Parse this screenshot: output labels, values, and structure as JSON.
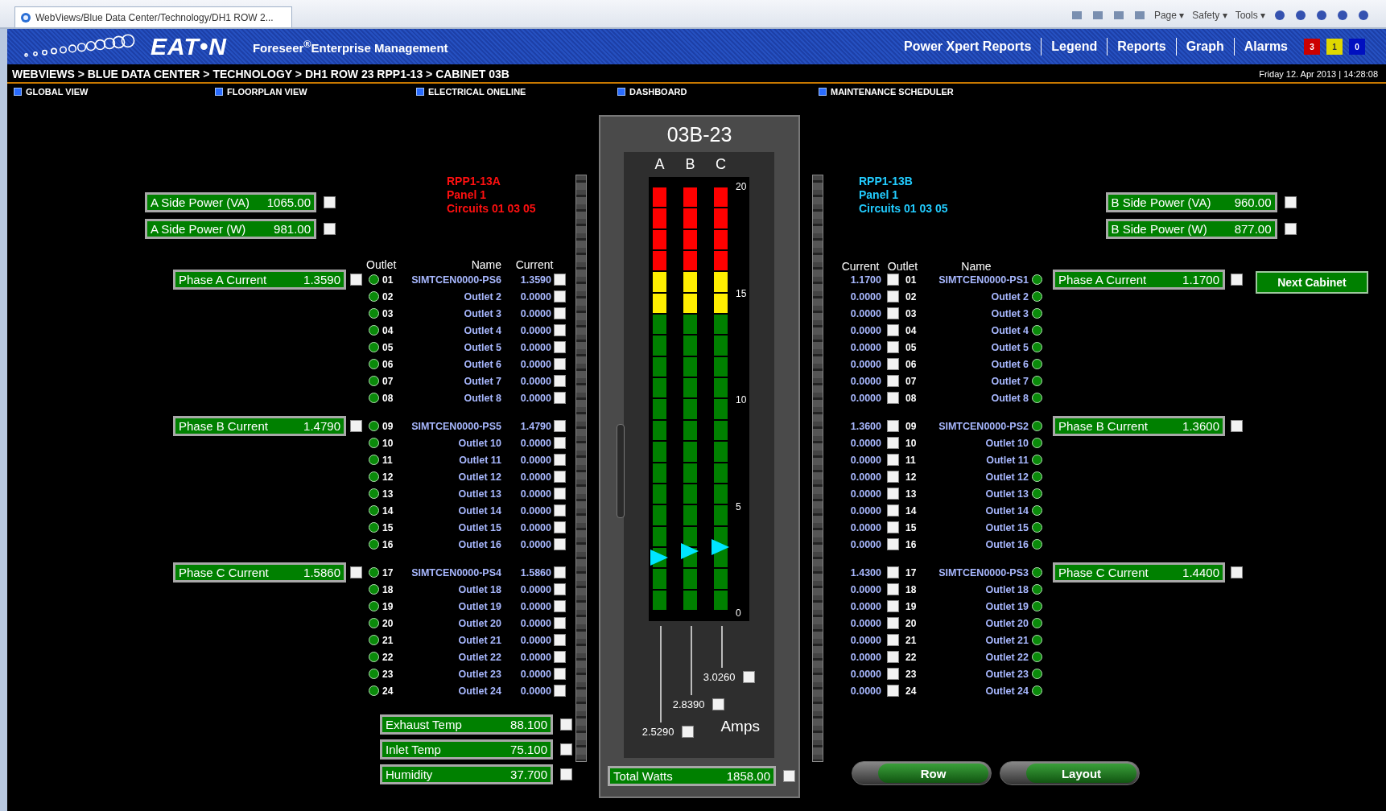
{
  "browser": {
    "tab_title": "WebViews/Blue Data Center/Technology/DH1 ROW 2...",
    "menus": [
      "Page ▾",
      "Safety ▾",
      "Tools ▾"
    ]
  },
  "header": {
    "logo": "EAT•N",
    "product": "Foreseer$^{®}$Enterprise Management",
    "nav": [
      "Power Xpert Reports",
      "Legend",
      "Reports",
      "Graph",
      "Alarms"
    ],
    "alarms": [
      {
        "count": "3",
        "color": "#cc0000"
      },
      {
        "count": "1",
        "color": "#e0d800"
      },
      {
        "count": "0",
        "color": "#0010c0"
      }
    ]
  },
  "breadcrumb": "WEBVIEWS > BLUE DATA CENTER > TECHNOLOGY > DH1 ROW 23 RPP1-13 > CABINET 03B",
  "datetime": "Friday 12. Apr 2013 | 14:28:08",
  "quick_links": [
    "GLOBAL VIEW",
    "FLOORPLAN VIEW",
    "ELECTRICAL ONELINE",
    "DASHBOARD",
    "MAINTENANCE SCHEDULER"
  ],
  "side_a": {
    "rpp": [
      "RPP1-13A",
      "Panel 1",
      "Circuits 01 03 05"
    ],
    "power": [
      {
        "label": "A Side Power (VA)",
        "value": "1065.00",
        "checked": false
      },
      {
        "label": "A Side Power (W)",
        "value": "981.00",
        "checked": false
      }
    ],
    "columns": [
      "Outlet",
      "Name",
      "Current"
    ],
    "groups": [
      {
        "phase": {
          "label": "Phase A Current",
          "value": "1.3590",
          "checked": false
        },
        "outlets": [
          {
            "number": "01",
            "name": "SIMTCEN0000-PS6",
            "current": "1.3590",
            "checked": false
          },
          {
            "number": "02",
            "name": "Outlet 2",
            "current": "0.0000",
            "checked": false
          },
          {
            "number": "03",
            "name": "Outlet 3",
            "current": "0.0000",
            "checked": false
          },
          {
            "number": "04",
            "name": "Outlet 4",
            "current": "0.0000",
            "checked": false
          },
          {
            "number": "05",
            "name": "Outlet 5",
            "current": "0.0000",
            "checked": false
          },
          {
            "number": "06",
            "name": "Outlet 6",
            "current": "0.0000",
            "checked": false
          },
          {
            "number": "07",
            "name": "Outlet 7",
            "current": "0.0000",
            "checked": false
          },
          {
            "number": "08",
            "name": "Outlet 8",
            "current": "0.0000",
            "checked": false
          }
        ]
      },
      {
        "phase": {
          "label": "Phase B Current",
          "value": "1.4790",
          "checked": false
        },
        "outlets": [
          {
            "number": "09",
            "name": "SIMTCEN0000-PS5",
            "current": "1.4790",
            "checked": false
          },
          {
            "number": "10",
            "name": "Outlet 10",
            "current": "0.0000",
            "checked": false
          },
          {
            "number": "11",
            "name": "Outlet 11",
            "current": "0.0000",
            "checked": false
          },
          {
            "number": "12",
            "name": "Outlet 12",
            "current": "0.0000",
            "checked": false
          },
          {
            "number": "13",
            "name": "Outlet 13",
            "current": "0.0000",
            "checked": false
          },
          {
            "number": "14",
            "name": "Outlet 14",
            "current": "0.0000",
            "checked": false
          },
          {
            "number": "15",
            "name": "Outlet 15",
            "current": "0.0000",
            "checked": false
          },
          {
            "number": "16",
            "name": "Outlet 16",
            "current": "0.0000",
            "checked": false
          }
        ]
      },
      {
        "phase": {
          "label": "Phase C Current",
          "value": "1.5860",
          "checked": false
        },
        "outlets": [
          {
            "number": "17",
            "name": "SIMTCEN0000-PS4",
            "current": "1.5860",
            "checked": false
          },
          {
            "number": "18",
            "name": "Outlet 18",
            "current": "0.0000",
            "checked": false
          },
          {
            "number": "19",
            "name": "Outlet 19",
            "current": "0.0000",
            "checked": false
          },
          {
            "number": "20",
            "name": "Outlet 20",
            "current": "0.0000",
            "checked": false
          },
          {
            "number": "21",
            "name": "Outlet 21",
            "current": "0.0000",
            "checked": false
          },
          {
            "number": "22",
            "name": "Outlet 22",
            "current": "0.0000",
            "checked": false
          },
          {
            "number": "23",
            "name": "Outlet 23",
            "current": "0.0000",
            "checked": false
          },
          {
            "number": "24",
            "name": "Outlet 24",
            "current": "0.0000",
            "checked": false
          }
        ]
      }
    ],
    "environment": [
      {
        "label": "Exhaust Temp",
        "value": "88.100",
        "checked": false
      },
      {
        "label": "Inlet Temp",
        "value": "75.100",
        "checked": false
      },
      {
        "label": "Humidity",
        "value": "37.700",
        "checked": false
      }
    ]
  },
  "cabinet": {
    "title": "03B-23",
    "scale": [
      "20",
      "15",
      "10",
      "5",
      "0"
    ],
    "unit": "Amps",
    "meters": [
      {
        "label": "A",
        "level": 0.1265,
        "reading": "2.5290",
        "checked": false
      },
      {
        "label": "B",
        "level": 0.142,
        "reading": "2.8390",
        "checked": false
      },
      {
        "label": "C",
        "level": 0.1513,
        "reading": "3.0260",
        "checked": false
      }
    ],
    "total": {
      "label": "Total Watts",
      "value": "1858.00",
      "checked": false
    }
  },
  "side_b": {
    "rpp": [
      "RPP1-13B",
      "Panel 1",
      "Circuits 01 03 05"
    ],
    "power": [
      {
        "label": "B Side Power (VA)",
        "value": "960.00",
        "checked": false
      },
      {
        "label": "B Side Power (W)",
        "value": "877.00",
        "checked": false
      }
    ],
    "columns": [
      "Current",
      "Outlet",
      "Name"
    ],
    "groups": [
      {
        "phase": {
          "label": "Phase A Current",
          "value": "1.1700",
          "checked": false
        },
        "outlets": [
          {
            "number": "01",
            "name": "SIMTCEN0000-PS1",
            "current": "1.1700",
            "checked": false
          },
          {
            "number": "02",
            "name": "Outlet 2",
            "current": "0.0000",
            "checked": false
          },
          {
            "number": "03",
            "name": "Outlet 3",
            "current": "0.0000",
            "checked": false
          },
          {
            "number": "04",
            "name": "Outlet 4",
            "current": "0.0000",
            "checked": false
          },
          {
            "number": "05",
            "name": "Outlet 5",
            "current": "0.0000",
            "checked": false
          },
          {
            "number": "06",
            "name": "Outlet 6",
            "current": "0.0000",
            "checked": false
          },
          {
            "number": "07",
            "name": "Outlet 7",
            "current": "0.0000",
            "checked": false
          },
          {
            "number": "08",
            "name": "Outlet 8",
            "current": "0.0000",
            "checked": false
          }
        ]
      },
      {
        "phase": {
          "label": "Phase B Current",
          "value": "1.3600",
          "checked": false
        },
        "outlets": [
          {
            "number": "09",
            "name": "SIMTCEN0000-PS2",
            "current": "1.3600",
            "checked": false
          },
          {
            "number": "10",
            "name": "Outlet 10",
            "current": "0.0000",
            "checked": false
          },
          {
            "number": "11",
            "name": "Outlet 11",
            "current": "0.0000",
            "checked": false
          },
          {
            "number": "12",
            "name": "Outlet 12",
            "current": "0.0000",
            "checked": false
          },
          {
            "number": "13",
            "name": "Outlet 13",
            "current": "0.0000",
            "checked": false
          },
          {
            "number": "14",
            "name": "Outlet 14",
            "current": "0.0000",
            "checked": false
          },
          {
            "number": "15",
            "name": "Outlet 15",
            "current": "0.0000",
            "checked": false
          },
          {
            "number": "16",
            "name": "Outlet 16",
            "current": "0.0000",
            "checked": false
          }
        ]
      },
      {
        "phase": {
          "label": "Phase C Current",
          "value": "1.4400",
          "checked": false
        },
        "outlets": [
          {
            "number": "17",
            "name": "SIMTCEN0000-PS3",
            "current": "1.4300",
            "checked": false
          },
          {
            "number": "18",
            "name": "Outlet 18",
            "current": "0.0000",
            "checked": false
          },
          {
            "number": "19",
            "name": "Outlet 19",
            "current": "0.0000",
            "checked": false
          },
          {
            "number": "20",
            "name": "Outlet 20",
            "current": "0.0000",
            "checked": false
          },
          {
            "number": "21",
            "name": "Outlet 21",
            "current": "0.0000",
            "checked": false
          },
          {
            "number": "22",
            "name": "Outlet 22",
            "current": "0.0000",
            "checked": false
          },
          {
            "number": "23",
            "name": "Outlet 23",
            "current": "0.0000",
            "checked": false
          },
          {
            "number": "24",
            "name": "Outlet 24",
            "current": "0.0000",
            "checked": false
          }
        ]
      }
    ],
    "next_button": "Next Cabinet",
    "buttons": [
      "Row",
      "Layout"
    ]
  }
}
